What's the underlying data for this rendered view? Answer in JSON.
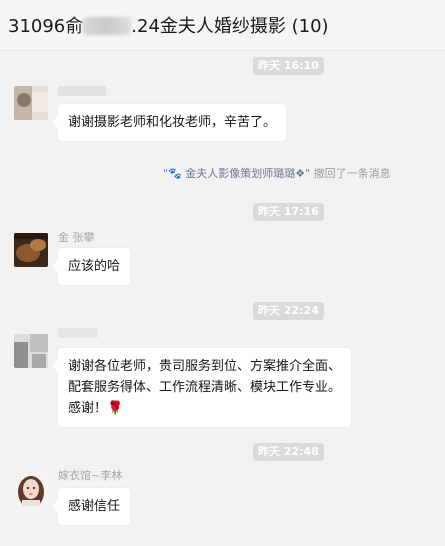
{
  "header": {
    "title_prefix": "31096俞",
    "title_suffix": ".24金夫人婚纱摄影 (10)"
  },
  "messages": [
    {
      "time": "昨天 16:10",
      "name": "",
      "text": "谢谢摄影老师和化妆老师，辛苦了。"
    },
    {
      "recall": {
        "name": "\"🐾 金夫人影像策划师璐璐❖\"",
        "action": "撤回了一条消息"
      }
    },
    {
      "time": "昨天 17:16",
      "name": "金 张攀",
      "text": "应该的哈"
    },
    {
      "time": "昨天 22:24",
      "name": "",
      "text_lines": [
        "谢谢各位老师，贵司服务到位、方案推介全面、",
        "配套服务得体、工作流程清晰、模块工作专业。",
        "感谢！🌹"
      ]
    },
    {
      "time": "昨天 22:48",
      "name": "嫁衣馆~李林",
      "text": "感谢信任"
    }
  ],
  "colors": {
    "background": "#f2f2f2",
    "bubble": "#ffffff",
    "time_badge": "#dadada",
    "name_text": "#a8a8a8"
  }
}
